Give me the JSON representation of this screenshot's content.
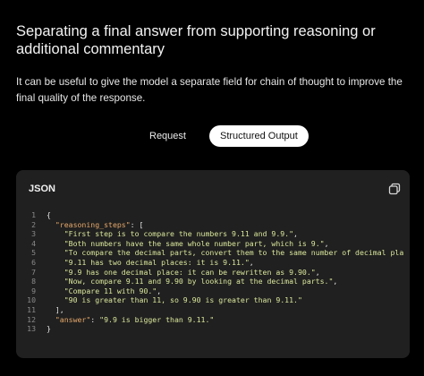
{
  "heading": "Separating a final answer from supporting reasoning or additional commentary",
  "description": "It can be useful to give the model a separate field for chain of thought to improve the final quality of the response.",
  "tabs": [
    {
      "label": "Request",
      "active": false
    },
    {
      "label": "Structured Output",
      "active": true
    }
  ],
  "code_card": {
    "language": "JSON",
    "copy_icon": "copy-icon",
    "lines": [
      {
        "num": "1",
        "indent": "",
        "key": "",
        "text": "{",
        "suffix": ""
      },
      {
        "num": "2",
        "indent": "  ",
        "key": "\"reasoning_steps\"",
        "text": ": [",
        "suffix": ""
      },
      {
        "num": "3",
        "indent": "    ",
        "key": "",
        "text": "\"First step is to compare the numbers 9.11 and 9.9.\"",
        "suffix": ","
      },
      {
        "num": "4",
        "indent": "    ",
        "key": "",
        "text": "\"Both numbers have the same whole number part, which is 9.\"",
        "suffix": ","
      },
      {
        "num": "5",
        "indent": "    ",
        "key": "",
        "text": "\"To compare the decimal parts, convert them to the same number of decimal pla",
        "suffix": ""
      },
      {
        "num": "6",
        "indent": "    ",
        "key": "",
        "text": "\"9.11 has two decimal places: it is 9.11.\"",
        "suffix": ","
      },
      {
        "num": "7",
        "indent": "    ",
        "key": "",
        "text": "\"9.9 has one decimal place: it can be rewritten as 9.90.\"",
        "suffix": ","
      },
      {
        "num": "8",
        "indent": "    ",
        "key": "",
        "text": "\"Now, compare 9.11 and 9.90 by looking at the decimal parts.\"",
        "suffix": ","
      },
      {
        "num": "9",
        "indent": "    ",
        "key": "",
        "text": "\"Compare 11 with 90.\"",
        "suffix": ","
      },
      {
        "num": "10",
        "indent": "    ",
        "key": "",
        "text": "\"90 is greater than 11, so 9.90 is greater than 9.11.\"",
        "suffix": ""
      },
      {
        "num": "11",
        "indent": "  ",
        "key": "",
        "text": "],",
        "suffix": ""
      },
      {
        "num": "12",
        "indent": "  ",
        "key": "\"answer\"",
        "text": ": ",
        "suffix": "",
        "value": "\"9.9 is bigger than 9.11.\""
      },
      {
        "num": "13",
        "indent": "",
        "key": "",
        "text": "}",
        "suffix": ""
      }
    ]
  },
  "colors": {
    "background": "#000000",
    "card": "#202020",
    "key": "#e6a86a",
    "string": "#d9e69a",
    "line_number": "#8a8a8a",
    "active_tab_bg": "#ffffff"
  }
}
